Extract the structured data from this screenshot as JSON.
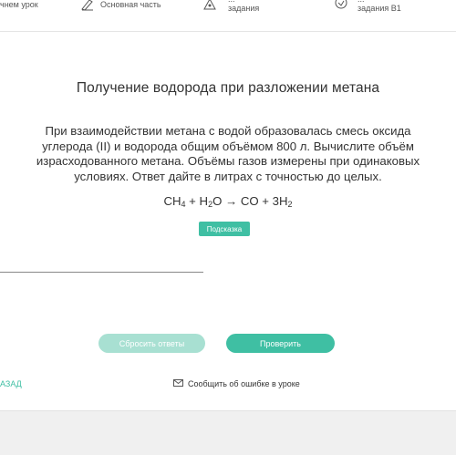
{
  "nav": {
    "item1": "чнем урок",
    "item2": "Основная часть",
    "item3_line1": "...",
    "item3_line2": "задания",
    "item4_line1": "...",
    "item4_line2": "задания В1"
  },
  "task": {
    "title": "Получение водорода при разложении метана",
    "lines": [
      "При взаимодействии метана с водой образовалась смесь оксида",
      "углерода (II) и водорода общим объёмом 800 л. Вычислите объём",
      "израсходованного метана. Объёмы газов измерены при одинаковых",
      "условиях. Ответ дайте в литрах с точностью до целых."
    ],
    "equation": {
      "ch": "CH",
      "ch_sub": "4",
      "plus1": " + H",
      "h_sub": "2",
      "o_arrow": "O → CO + 3H",
      "h2_sub": "2"
    },
    "hint_label": "Подсказка"
  },
  "actions": {
    "reset_label": "Сбросить ответы",
    "check_label": "Проверить",
    "back_label": "АЗАД",
    "report_label": "Сообщить об ошибке в уроке"
  },
  "colors": {
    "accent": "#3fbfa3",
    "accent_light": "#a8e0d2"
  }
}
